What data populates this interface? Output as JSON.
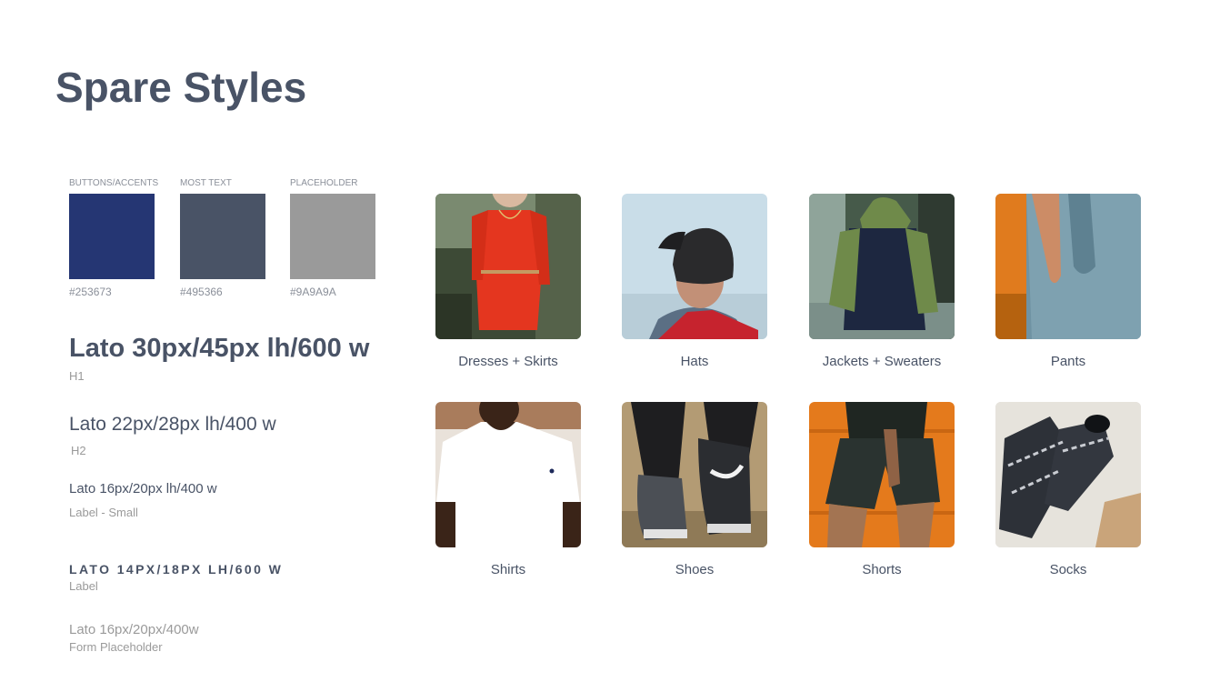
{
  "title": "Spare Styles",
  "swatches": [
    {
      "label": "BUTTONS/ACCENTS",
      "hex": "#253673",
      "color": "#253673"
    },
    {
      "label": "MOST TEXT",
      "hex": "#495366",
      "color": "#495366"
    },
    {
      "label": "PLACEHOLDER",
      "hex": "#9A9A9A",
      "color": "#9A9A9A"
    }
  ],
  "typography": {
    "h1": {
      "sample": "Lato 30px/45px lh/600 w",
      "name": "H1"
    },
    "h2": {
      "sample": "Lato 22px/28px lh/400 w",
      "name": "H2"
    },
    "label_small": {
      "sample": "Lato 16px/20px lh/400 w",
      "name": "Label - Small"
    },
    "label": {
      "sample": "LATO 14PX/18PX LH/600 W",
      "name": "Label"
    },
    "placeholder": {
      "sample": "Lato 16px/20px/400w",
      "name": "Form Placeholder"
    }
  },
  "categories": [
    {
      "label": "Dresses + Skirts",
      "icon": "dress-photo"
    },
    {
      "label": "Hats",
      "icon": "hat-photo"
    },
    {
      "label": "Jackets + Sweaters",
      "icon": "jacket-photo"
    },
    {
      "label": "Pants",
      "icon": "pants-photo"
    },
    {
      "label": "Shirts",
      "icon": "shirt-photo"
    },
    {
      "label": "Shoes",
      "icon": "shoes-photo"
    },
    {
      "label": "Shorts",
      "icon": "shorts-photo"
    },
    {
      "label": "Socks",
      "icon": "socks-photo"
    }
  ]
}
